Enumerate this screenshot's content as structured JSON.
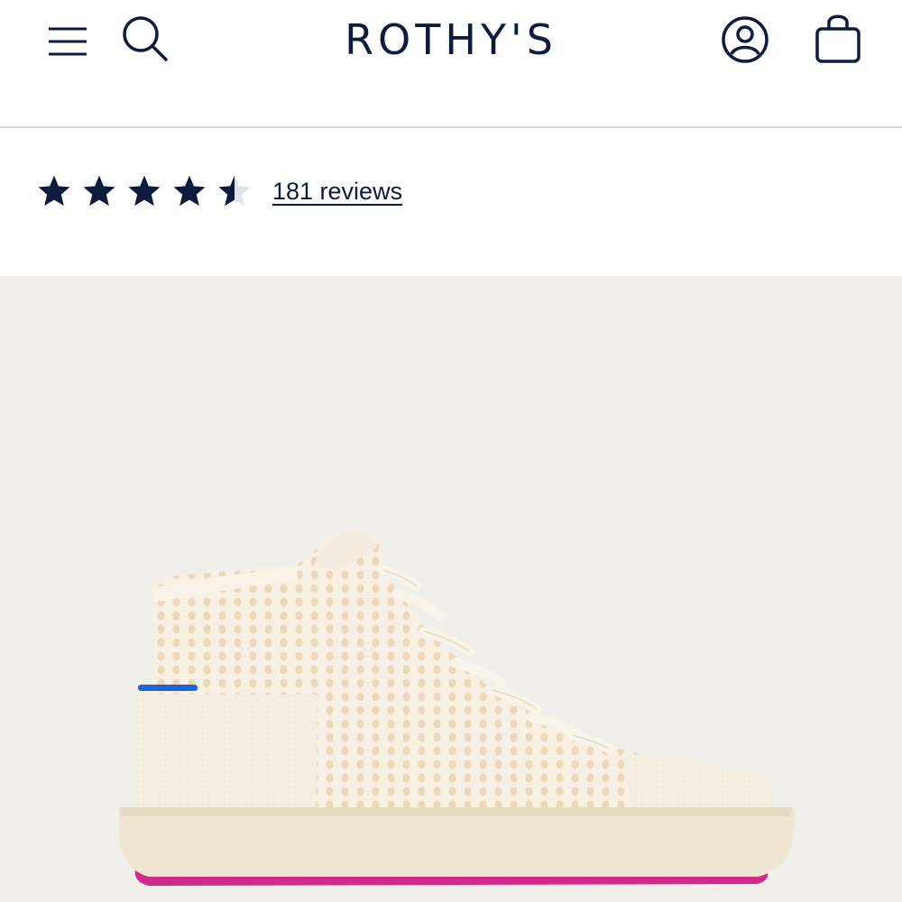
{
  "header": {
    "brand": "ROTHY'S",
    "menu_icon": "hamburger-menu-icon",
    "search_icon": "search-icon",
    "account_icon": "account-user-icon",
    "cart_icon": "shopping-bag-icon"
  },
  "rating": {
    "value": 4.5,
    "max": 5,
    "reviews_label": "181 reviews"
  },
  "product": {
    "image_alt": "Cream knit high-top sneaker with pink outsole and blue heel stripe"
  },
  "colors": {
    "brand_navy": "#0d1b3e",
    "image_background": "#f1efea",
    "shoe_cream": "#f6efe2",
    "sole_pink": "#d12a8a",
    "heel_blue": "#1e64d6"
  }
}
